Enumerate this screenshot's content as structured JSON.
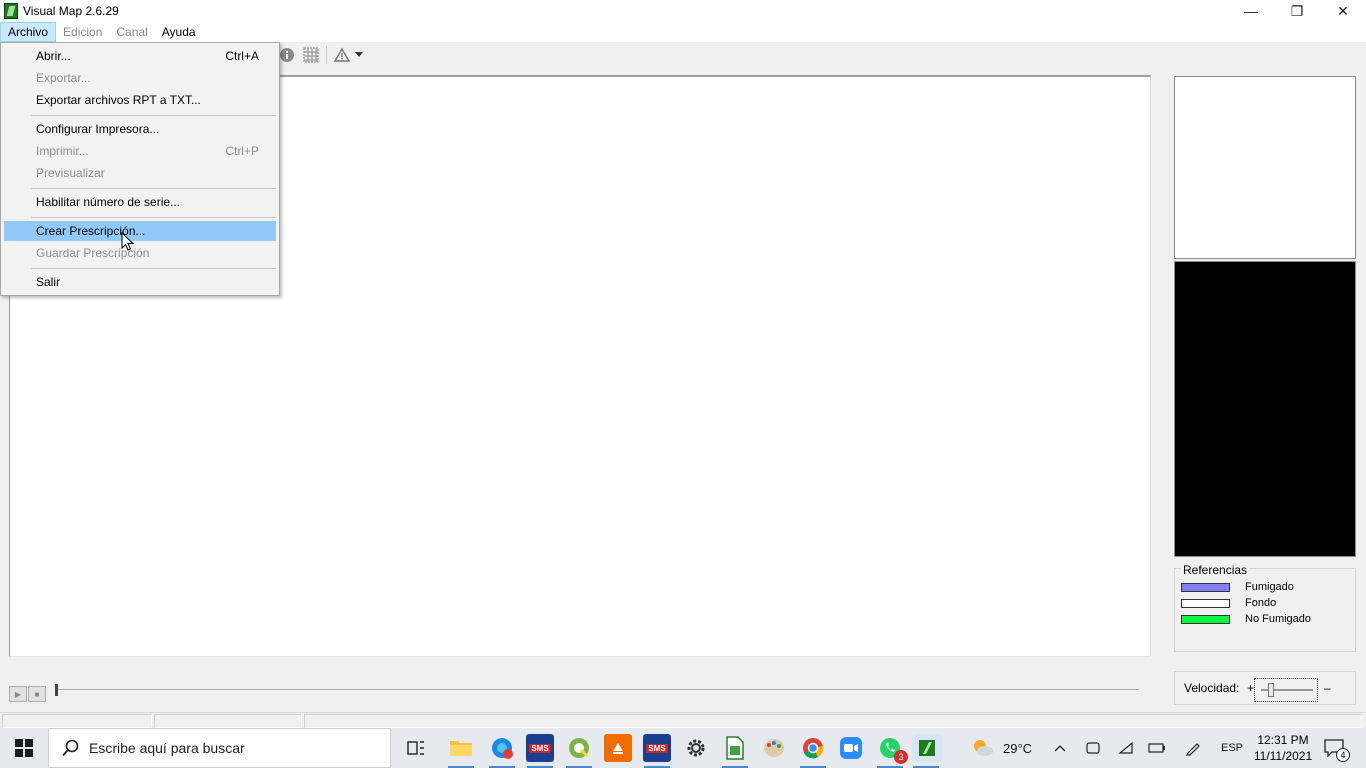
{
  "window": {
    "title": "Visual Map 2.6.29",
    "controls": {
      "minimize": "—",
      "restore": "❐",
      "close": "✕"
    }
  },
  "menubar": [
    {
      "label": "Archivo",
      "state": "active"
    },
    {
      "label": "Edicion",
      "state": "disabled"
    },
    {
      "label": "Canal",
      "state": "disabled"
    },
    {
      "label": "Ayuda",
      "state": "normal"
    }
  ],
  "dropdown": {
    "items": [
      {
        "label": "Abrir...",
        "shortcut": "Ctrl+A",
        "enabled": true
      },
      {
        "label": "Exportar...",
        "shortcut": "",
        "enabled": false
      },
      {
        "label": "Exportar archivos RPT a TXT...",
        "shortcut": "",
        "enabled": true
      },
      {
        "label": "Configurar Impresora...",
        "shortcut": "",
        "enabled": true
      },
      {
        "label": "Imprimir...",
        "shortcut": "Ctrl+P",
        "enabled": false
      },
      {
        "label": "Previsualizar",
        "shortcut": "",
        "enabled": false
      },
      {
        "label": "Habilitar número de serie...",
        "shortcut": "",
        "enabled": true
      },
      {
        "label": "Crear Prescripción...",
        "shortcut": "",
        "enabled": true,
        "highlighted": true
      },
      {
        "label": "Guardar Prescripción",
        "shortcut": "",
        "enabled": false
      },
      {
        "label": "Salir",
        "shortcut": "",
        "enabled": true
      }
    ]
  },
  "toolbar": {
    "icons": [
      "info-icon",
      "grid-icon",
      "warning-icon",
      "dropdown-arrow-icon"
    ]
  },
  "references": {
    "title": "Referencias",
    "items": [
      {
        "label": "Fumigado",
        "color": "#8080ff"
      },
      {
        "label": "Fondo",
        "color": "#ffffff"
      },
      {
        "label": "No Fumigado",
        "color": "#00ff40"
      }
    ]
  },
  "speed": {
    "label": "Velocidad:",
    "plus": "+",
    "minus": "–",
    "level": 0.15
  },
  "playback": {
    "play": "▶",
    "stop": "■",
    "position": 0
  },
  "taskbar": {
    "search_placeholder": "Escribe aquí para buscar",
    "apps": [
      {
        "name": "task-view-icon",
        "label": ""
      },
      {
        "name": "file-explorer-icon",
        "label": ""
      },
      {
        "name": "edge-icon",
        "label": ""
      },
      {
        "name": "sms-app-icon",
        "label": "SMS"
      },
      {
        "name": "qgis-icon",
        "label": "Q"
      },
      {
        "name": "orange-app-icon",
        "label": ""
      },
      {
        "name": "sms-app-icon-2",
        "label": "SMS"
      },
      {
        "name": "settings-icon",
        "label": ""
      },
      {
        "name": "spreadsheet-icon",
        "label": ""
      },
      {
        "name": "paint-icon",
        "label": ""
      },
      {
        "name": "chrome-icon",
        "label": ""
      },
      {
        "name": "zoom-icon",
        "label": ""
      },
      {
        "name": "whatsapp-icon",
        "label": "",
        "badge": "3"
      },
      {
        "name": "visual-map-icon",
        "label": ""
      }
    ],
    "weather": "29°C",
    "language": "ESP",
    "time": "12:31 PM",
    "date": "11/11/2021",
    "notifications": "4"
  }
}
